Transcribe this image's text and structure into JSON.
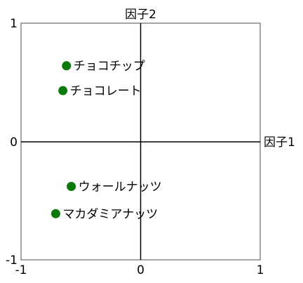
{
  "chart_data": {
    "type": "scatter",
    "xlabel": "因子1",
    "ylabel": "因子2",
    "xlim": [
      -1,
      1
    ],
    "ylim": [
      -1,
      1
    ],
    "x_ticks": [
      "-1",
      "0",
      "1"
    ],
    "y_ticks": [
      "-1",
      "0",
      "1"
    ],
    "grid": false,
    "zero_lines": true,
    "marker_color": "#0a7a0a",
    "points": [
      {
        "label": "チョコチップ",
        "x": -0.62,
        "y": 0.64
      },
      {
        "label": "チョコレート",
        "x": -0.65,
        "y": 0.43
      },
      {
        "label": "ウォールナッツ",
        "x": -0.58,
        "y": -0.38
      },
      {
        "label": "マカダミアナッツ",
        "x": -0.71,
        "y": -0.61
      }
    ]
  }
}
